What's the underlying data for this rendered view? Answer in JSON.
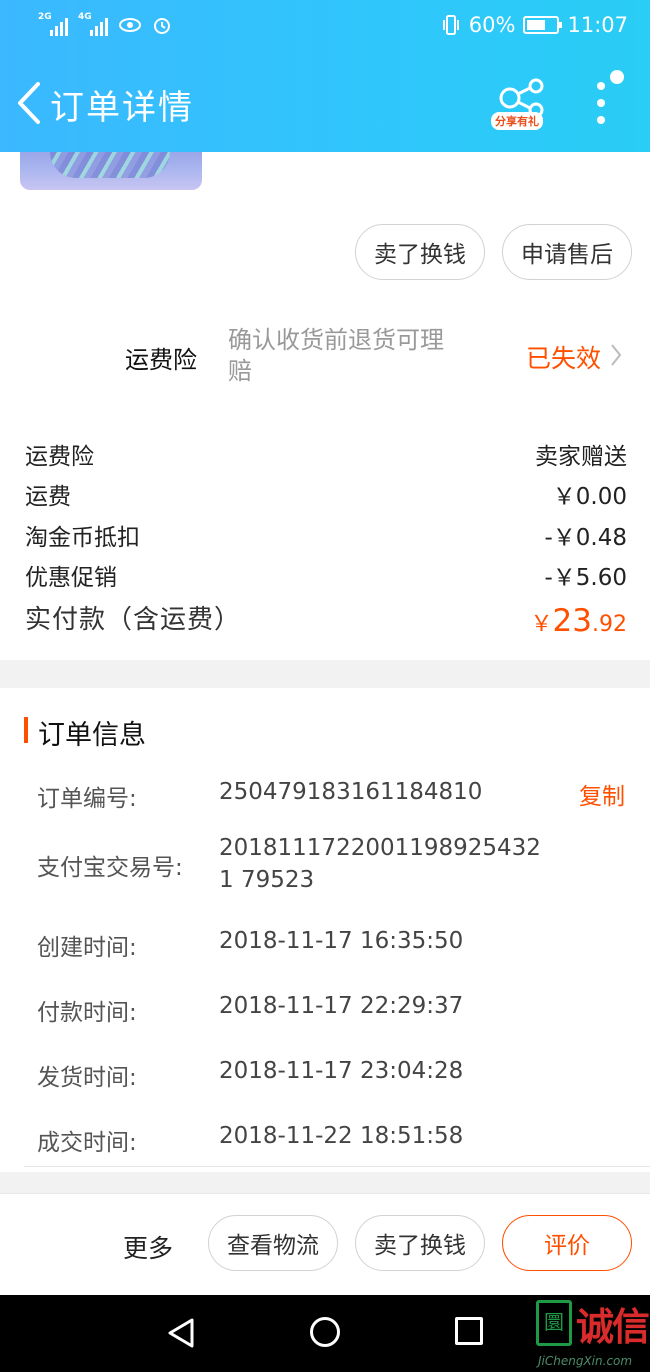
{
  "status_bar": {
    "net1": "2G",
    "net2": "4G",
    "battery": "60%",
    "time": "11:07"
  },
  "header": {
    "title": "订单详情",
    "share_label": "分享有礼"
  },
  "actions_top": {
    "sell": "卖了换钱",
    "after_sale": "申请售后"
  },
  "insurance": {
    "label": "运费险",
    "desc": "确认收货前退货可理赔",
    "status": "已失效"
  },
  "costs": [
    {
      "label": "运费险",
      "value": "卖家赠送"
    },
    {
      "label": "运费",
      "value": "￥0.00"
    },
    {
      "label": "淘金币抵扣",
      "value": "-￥0.48"
    },
    {
      "label": "优惠促销",
      "value": "-￥5.60"
    }
  ],
  "total": {
    "label": "实付款（含运费）",
    "currency": "￥",
    "integer": "23",
    "decimal": ".92"
  },
  "order_info": {
    "title": "订单信息",
    "copy": "复制",
    "rows": [
      {
        "label": "订单编号:",
        "value": "250479183161184810"
      },
      {
        "label": "支付宝交易号:",
        "value": "20181117220011989254321 79523"
      },
      {
        "label": "创建时间:",
        "value": "2018-11-17 16:35:50"
      },
      {
        "label": "付款时间:",
        "value": "2018-11-17 22:29:37"
      },
      {
        "label": "发货时间:",
        "value": "2018-11-17 23:04:28"
      },
      {
        "label": "成交时间:",
        "value": "2018-11-22 18:51:58"
      }
    ]
  },
  "bottom_bar": {
    "more": "更多",
    "logistics": "查看物流",
    "sell": "卖了换钱",
    "review": "评价"
  },
  "watermark": {
    "mark": "圜",
    "text": "诚信",
    "url": "JiChengXin.com"
  },
  "colors": {
    "header": "#2fc7fb",
    "accent": "#ff5000"
  }
}
